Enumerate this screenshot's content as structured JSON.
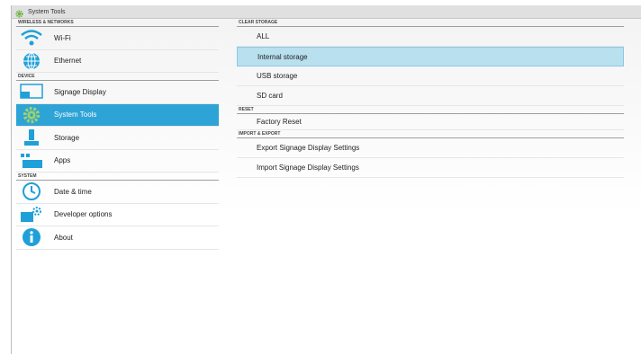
{
  "window": {
    "title": "System Tools",
    "icon": "gear-icon"
  },
  "left": {
    "sections": [
      {
        "header": "WIRELESS & NETWORKS",
        "items": [
          {
            "label": "Wi-Fi",
            "icon": "wifi-icon"
          },
          {
            "label": "Ethernet",
            "icon": "globe-icon"
          }
        ]
      },
      {
        "header": "DEVICE",
        "items": [
          {
            "label": "Signage Display",
            "icon": "display-icon"
          },
          {
            "label": "System Tools",
            "icon": "gear-icon",
            "active": true
          },
          {
            "label": "Storage",
            "icon": "storage-icon"
          },
          {
            "label": "Apps",
            "icon": "apps-icon"
          }
        ]
      },
      {
        "header": "SYSTEM",
        "items": [
          {
            "label": "Date & time",
            "icon": "clock-icon"
          },
          {
            "label": "Developer options",
            "icon": "developer-icon"
          },
          {
            "label": "About",
            "icon": "info-icon"
          }
        ]
      }
    ]
  },
  "right": {
    "clear_storage": {
      "header": "CLEAR STORAGE",
      "items": [
        "ALL",
        "Internal storage",
        "USB storage",
        "SD card"
      ],
      "selected": "Internal storage"
    },
    "reset": {
      "header": "RESET",
      "items": [
        "Factory Reset"
      ]
    },
    "import_export": {
      "header": "IMPORT & EXPORT",
      "items": [
        "Export Signage Display Settings",
        "Import Signage Display Settings"
      ]
    }
  },
  "colors": {
    "active": "#2ea3d6",
    "selected": "#b8e0ef",
    "icon": "#1fa0d8"
  }
}
